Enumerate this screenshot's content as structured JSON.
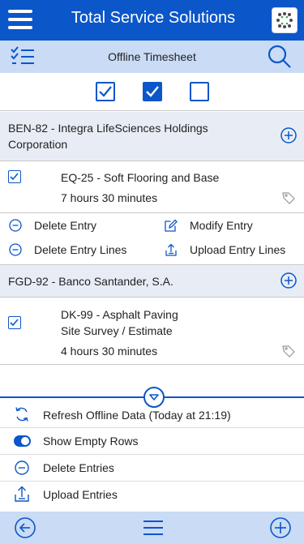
{
  "header": {
    "title": "Total Service Solutions"
  },
  "subheader": {
    "title": "Offline Timesheet"
  },
  "groups": [
    {
      "title_line1": "BEN-82 - Integra LifeSciences Holdings",
      "title_line2": "Corporation",
      "entry": {
        "line1": "EQ-25 - Soft Flooring and Base",
        "duration": "7 hours 30 minutes"
      },
      "actions": {
        "delete_entry": "Delete Entry",
        "modify_entry": "Modify Entry",
        "delete_entry_lines": "Delete Entry Lines",
        "upload_entry_lines": "Upload Entry Lines"
      }
    },
    {
      "title_line1": "FGD-92 - Banco Santander, S.A.",
      "entry": {
        "line1": "DK-99 - Asphalt Paving",
        "line2": "Site Survey / Estimate",
        "duration": "4 hours 30 minutes"
      }
    }
  ],
  "footer_menu": {
    "refresh": "Refresh Offline Data (Today at 21:19)",
    "show_empty_rows": "Show Empty Rows",
    "delete_entries": "Delete Entries",
    "upload_entries": "Upload Entries"
  },
  "colors": {
    "brand": "#0b56c9",
    "subbar": "#c9dbf5",
    "group_bg": "#e8edf5"
  }
}
